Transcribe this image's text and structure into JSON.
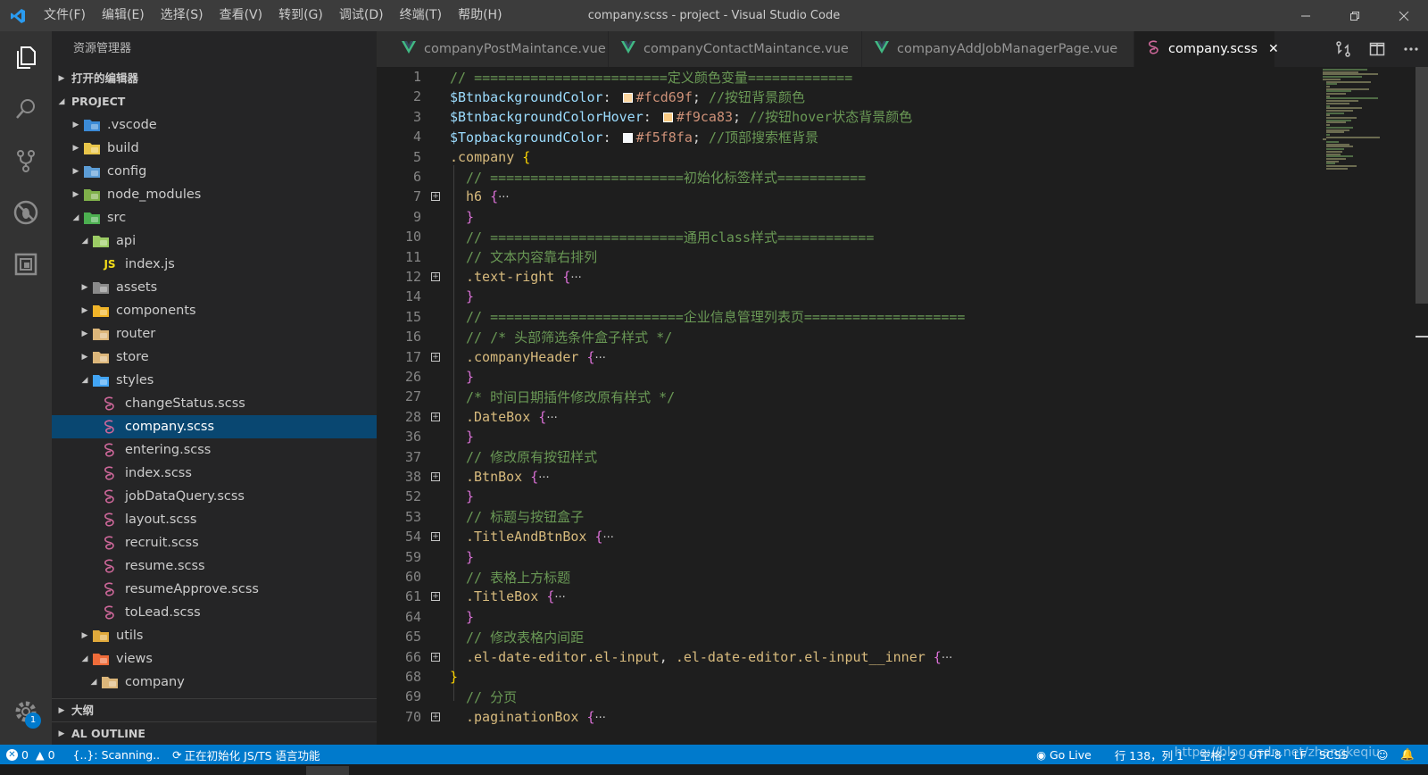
{
  "window": {
    "title": "company.scss - project - Visual Studio Code",
    "menu": [
      "文件(F)",
      "编辑(E)",
      "选择(S)",
      "查看(V)",
      "转到(G)",
      "调试(D)",
      "终端(T)",
      "帮助(H)"
    ]
  },
  "activity_bar": {
    "items": [
      "files-icon",
      "search-icon",
      "source-control-icon",
      "debug-icon",
      "extensions-icon"
    ],
    "manage_badge": "1"
  },
  "sidebar": {
    "title": "资源管理器",
    "open_editors_label": "打开的编辑器",
    "project_label": "PROJECT",
    "tree": [
      {
        "label": ".vscode",
        "type": "folder",
        "level": 1,
        "expanded": false,
        "icon": "vscode-folder-icon",
        "color": "#3b8ad6"
      },
      {
        "label": "build",
        "type": "folder",
        "level": 1,
        "expanded": false,
        "icon": "build-folder-icon",
        "color": "#e8c54a"
      },
      {
        "label": "config",
        "type": "folder",
        "level": 1,
        "expanded": false,
        "icon": "config-folder-icon",
        "color": "#5c9dd6"
      },
      {
        "label": "node_modules",
        "type": "folder",
        "level": 1,
        "expanded": false,
        "icon": "node-folder-icon",
        "color": "#7fb04a"
      },
      {
        "label": "src",
        "type": "folder",
        "level": 1,
        "expanded": true,
        "icon": "src-folder-icon",
        "color": "#4caf50"
      },
      {
        "label": "api",
        "type": "folder",
        "level": 2,
        "expanded": true,
        "icon": "api-folder-icon",
        "color": "#9ccc65"
      },
      {
        "label": "index.js",
        "type": "file",
        "level": 3,
        "icon": "js-file-icon",
        "color": "#f5de19"
      },
      {
        "label": "assets",
        "type": "folder",
        "level": 2,
        "expanded": false,
        "icon": "assets-folder-icon",
        "color": "#8a8a8a"
      },
      {
        "label": "components",
        "type": "folder",
        "level": 2,
        "expanded": false,
        "icon": "components-folder-icon",
        "color": "#f0b429"
      },
      {
        "label": "router",
        "type": "folder",
        "level": 2,
        "expanded": false,
        "icon": "folder-icon",
        "color": "#dcb67a"
      },
      {
        "label": "store",
        "type": "folder",
        "level": 2,
        "expanded": false,
        "icon": "folder-icon",
        "color": "#dcb67a"
      },
      {
        "label": "styles",
        "type": "folder",
        "level": 2,
        "expanded": true,
        "icon": "styles-folder-icon",
        "color": "#42a5f5"
      },
      {
        "label": "changeStatus.scss",
        "type": "file",
        "level": 3,
        "icon": "scss-file-icon",
        "color": "#cd6799"
      },
      {
        "label": "company.scss",
        "type": "file",
        "level": 3,
        "icon": "scss-file-icon",
        "color": "#cd6799",
        "selected": true
      },
      {
        "label": "entering.scss",
        "type": "file",
        "level": 3,
        "icon": "scss-file-icon",
        "color": "#cd6799"
      },
      {
        "label": "index.scss",
        "type": "file",
        "level": 3,
        "icon": "scss-file-icon",
        "color": "#cd6799"
      },
      {
        "label": "jobDataQuery.scss",
        "type": "file",
        "level": 3,
        "icon": "scss-file-icon",
        "color": "#cd6799"
      },
      {
        "label": "layout.scss",
        "type": "file",
        "level": 3,
        "icon": "scss-file-icon",
        "color": "#cd6799"
      },
      {
        "label": "recruit.scss",
        "type": "file",
        "level": 3,
        "icon": "scss-file-icon",
        "color": "#cd6799"
      },
      {
        "label": "resume.scss",
        "type": "file",
        "level": 3,
        "icon": "scss-file-icon",
        "color": "#cd6799"
      },
      {
        "label": "resumeApprove.scss",
        "type": "file",
        "level": 3,
        "icon": "scss-file-icon",
        "color": "#cd6799"
      },
      {
        "label": "toLead.scss",
        "type": "file",
        "level": 3,
        "icon": "scss-file-icon",
        "color": "#cd6799"
      },
      {
        "label": "utils",
        "type": "folder",
        "level": 2,
        "expanded": false,
        "icon": "utils-folder-icon",
        "color": "#e0a93b"
      },
      {
        "label": "views",
        "type": "folder",
        "level": 2,
        "expanded": true,
        "icon": "views-folder-icon",
        "color": "#ef6c3a"
      },
      {
        "label": "company",
        "type": "folder",
        "level": 3,
        "expanded": true,
        "icon": "folder-icon",
        "color": "#dcb67a"
      }
    ],
    "outline_label": "大纲",
    "al_outline_label": "AL OUTLINE"
  },
  "tabs": [
    {
      "label": "companyPostMaintance.vue",
      "icon": "vue-icon",
      "active": false
    },
    {
      "label": "companyContactMaintance.vue",
      "icon": "vue-icon",
      "active": false
    },
    {
      "label": "companyAddJobManagerPage.vue",
      "icon": "vue-icon",
      "active": false
    },
    {
      "label": "company.scss",
      "icon": "scss-icon",
      "active": true
    }
  ],
  "editor": {
    "lines": [
      {
        "n": "1",
        "fold": false,
        "indent": 0,
        "parts": [
          [
            "c-com",
            "// ========================定义颜色变量============="
          ]
        ]
      },
      {
        "n": "2",
        "fold": false,
        "indent": 0,
        "parts": [
          [
            "c-var",
            "$BtnbackgroundColor"
          ],
          [
            "c-plain",
            ": "
          ],
          [
            "swatch",
            "#fcd69f"
          ],
          [
            "c-val",
            "#fcd69f"
          ],
          [
            "c-plain",
            "; "
          ],
          [
            "c-com",
            "//按钮背景颜色"
          ]
        ]
      },
      {
        "n": "3",
        "fold": false,
        "indent": 0,
        "parts": [
          [
            "c-var",
            "$BtnbackgroundColorHover"
          ],
          [
            "c-plain",
            ": "
          ],
          [
            "swatch",
            "#f9ca83"
          ],
          [
            "c-val",
            "#f9ca83"
          ],
          [
            "c-plain",
            "; "
          ],
          [
            "c-com",
            "//按钮hover状态背景颜色"
          ]
        ]
      },
      {
        "n": "4",
        "fold": false,
        "indent": 0,
        "parts": [
          [
            "c-var",
            "$TopbackgroundColor"
          ],
          [
            "c-plain",
            ": "
          ],
          [
            "swatch",
            "#f5f8fa"
          ],
          [
            "c-val",
            "#f5f8fa"
          ],
          [
            "c-plain",
            "; "
          ],
          [
            "c-com",
            "//顶部搜索框背景"
          ]
        ]
      },
      {
        "n": "5",
        "fold": false,
        "indent": 0,
        "parts": [
          [
            "c-sel",
            ".company "
          ],
          [
            "c-brace2",
            "{"
          ]
        ]
      },
      {
        "n": "6",
        "fold": false,
        "indent": 1,
        "parts": [
          [
            "c-com",
            "// ========================初始化标签样式==========="
          ]
        ]
      },
      {
        "n": "7",
        "fold": true,
        "indent": 1,
        "parts": [
          [
            "c-tag",
            "h6 "
          ],
          [
            "c-brace",
            "{"
          ],
          [
            "dots",
            "···"
          ]
        ]
      },
      {
        "n": "9",
        "fold": false,
        "indent": 1,
        "parts": [
          [
            "c-brace",
            "}"
          ]
        ]
      },
      {
        "n": "10",
        "fold": false,
        "indent": 1,
        "parts": [
          [
            "c-com",
            "// ========================通用class样式============"
          ]
        ]
      },
      {
        "n": "11",
        "fold": false,
        "indent": 1,
        "parts": [
          [
            "c-com",
            "// 文本内容靠右排列"
          ]
        ]
      },
      {
        "n": "12",
        "fold": true,
        "indent": 1,
        "parts": [
          [
            "c-sel",
            ".text-right "
          ],
          [
            "c-brace",
            "{"
          ],
          [
            "dots",
            "···"
          ]
        ]
      },
      {
        "n": "14",
        "fold": false,
        "indent": 1,
        "parts": [
          [
            "c-brace",
            "}"
          ]
        ]
      },
      {
        "n": "15",
        "fold": false,
        "indent": 1,
        "parts": [
          [
            "c-com",
            "// ========================企业信息管理列表页===================="
          ]
        ]
      },
      {
        "n": "16",
        "fold": false,
        "indent": 1,
        "parts": [
          [
            "c-com",
            "// /* 头部筛选条件盒子样式 */"
          ]
        ]
      },
      {
        "n": "17",
        "fold": true,
        "indent": 1,
        "parts": [
          [
            "c-sel",
            ".companyHeader "
          ],
          [
            "c-brace",
            "{"
          ],
          [
            "dots",
            "···"
          ]
        ]
      },
      {
        "n": "26",
        "fold": false,
        "indent": 1,
        "parts": [
          [
            "c-brace",
            "}"
          ]
        ]
      },
      {
        "n": "27",
        "fold": false,
        "indent": 1,
        "parts": [
          [
            "c-com",
            "/* 时间日期插件修改原有样式 */"
          ]
        ]
      },
      {
        "n": "28",
        "fold": true,
        "indent": 1,
        "parts": [
          [
            "c-sel",
            ".DateBox "
          ],
          [
            "c-brace",
            "{"
          ],
          [
            "dots",
            "···"
          ]
        ]
      },
      {
        "n": "36",
        "fold": false,
        "indent": 1,
        "parts": [
          [
            "c-brace",
            "}"
          ]
        ]
      },
      {
        "n": "37",
        "fold": false,
        "indent": 1,
        "parts": [
          [
            "c-com",
            "// 修改原有按钮样式"
          ]
        ]
      },
      {
        "n": "38",
        "fold": true,
        "indent": 1,
        "parts": [
          [
            "c-sel",
            ".BtnBox "
          ],
          [
            "c-brace",
            "{"
          ],
          [
            "dots",
            "···"
          ]
        ]
      },
      {
        "n": "52",
        "fold": false,
        "indent": 1,
        "parts": [
          [
            "c-brace",
            "}"
          ]
        ]
      },
      {
        "n": "53",
        "fold": false,
        "indent": 1,
        "parts": [
          [
            "c-com",
            "// 标题与按钮盒子"
          ]
        ]
      },
      {
        "n": "54",
        "fold": true,
        "indent": 1,
        "parts": [
          [
            "c-sel",
            ".TitleAndBtnBox "
          ],
          [
            "c-brace",
            "{"
          ],
          [
            "dots",
            "···"
          ]
        ]
      },
      {
        "n": "59",
        "fold": false,
        "indent": 1,
        "parts": [
          [
            "c-brace",
            "}"
          ]
        ]
      },
      {
        "n": "60",
        "fold": false,
        "indent": 1,
        "parts": [
          [
            "c-com",
            "// 表格上方标题"
          ]
        ]
      },
      {
        "n": "61",
        "fold": true,
        "indent": 1,
        "parts": [
          [
            "c-sel",
            ".TitleBox "
          ],
          [
            "c-brace",
            "{"
          ],
          [
            "dots",
            "···"
          ]
        ]
      },
      {
        "n": "64",
        "fold": false,
        "indent": 1,
        "parts": [
          [
            "c-brace",
            "}"
          ]
        ]
      },
      {
        "n": "65",
        "fold": false,
        "indent": 1,
        "parts": [
          [
            "c-com",
            "// 修改表格内间距"
          ]
        ]
      },
      {
        "n": "66",
        "fold": true,
        "indent": 1,
        "parts": [
          [
            "c-sel",
            ".el-date-editor.el-input"
          ],
          [
            "c-plain",
            ", "
          ],
          [
            "c-sel",
            ".el-date-editor.el-input__inner "
          ],
          [
            "c-brace",
            "{"
          ],
          [
            "dots",
            "···"
          ]
        ]
      },
      {
        "n": "68",
        "fold": false,
        "indent": 0,
        "parts": [
          [
            "c-brace2",
            "}"
          ]
        ]
      },
      {
        "n": "69",
        "fold": false,
        "indent": 1,
        "parts": [
          [
            "c-com",
            "// 分页"
          ]
        ]
      },
      {
        "n": "70",
        "fold": true,
        "indent": 1,
        "parts": [
          [
            "c-sel",
            ".paginationBox "
          ],
          [
            "c-brace",
            "{"
          ],
          [
            "dots",
            "···"
          ]
        ]
      }
    ]
  },
  "statusbar": {
    "errors": "0",
    "warnings": "0",
    "scanning": "{..}: Scanning..",
    "init": "正在初始化 JS/TS 语言功能",
    "go_live": "Go Live",
    "position": "行 138，列 1",
    "spaces": "空格: 2",
    "encoding": "UTF-8",
    "eol": "LF",
    "language": "SCSS",
    "watermark": "https://blog.csdn.net/zhangkeqiu"
  }
}
